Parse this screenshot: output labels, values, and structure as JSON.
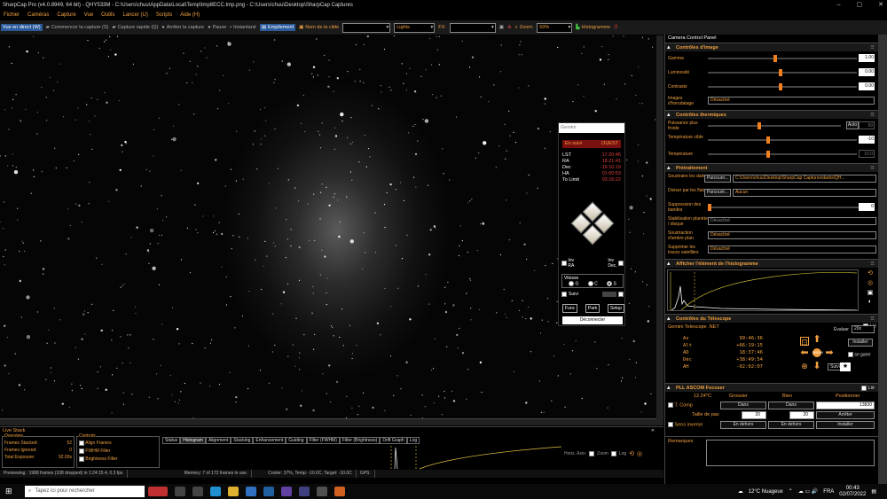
{
  "title": "SharpCap Pro (v4.0.8949, 64 bit) - QHY533M - C:\\Users\\chuu\\AppData\\Local\\Temp\\tmp8ECC.tmp.png - C:\\Users\\chuu\\Desktop\\SharpCap Captures",
  "menu": [
    "Fichier",
    "Caméras",
    "Capture",
    "Vue",
    "Outils",
    "Lancer (U)",
    "Scripts",
    "Aide (H)"
  ],
  "toolbar": {
    "live": "Vue en direct (W)",
    "start": "Commencer la capture (S)",
    "quick": "Capture rapide (Q)",
    "stop": "Arrêter la capture",
    "pause": "Pause",
    "snap": "Instantané",
    "stack": "Empilement",
    "target": "Nom de la cible",
    "preset": "Lights",
    "fx": "FX:",
    "zoom": "Zoom:",
    "zoom_val": "50%",
    "histo": "Histogramme"
  },
  "gemini": {
    "title": "Gemini",
    "status_l": "En suivi",
    "status_r": "OUEST",
    "rows": [
      [
        "LST",
        "17:20:45"
      ],
      [
        "RA",
        "18:21:41"
      ],
      [
        "Dec",
        "-16:10:19"
      ],
      [
        "HA",
        "01:00:53"
      ],
      [
        "To Limit",
        "03:16:22"
      ]
    ],
    "inv_ra": "Inv\nRA",
    "inv_dec": "Inv\nDec.",
    "speed": "Vitesse",
    "g": "G",
    "c": "C",
    "s": "S",
    "suivi": "Suivi",
    "func": "Func",
    "park": "Park",
    "setup": "Setup",
    "disconnect": "Déconnecter"
  },
  "panel": {
    "title": "Camera Control Panel",
    "img": {
      "head": "Contrôles d'image",
      "gamma": "Gamma",
      "gamma_v": "1.00",
      "lum": "Luminosité",
      "lum_v": "0.00",
      "con": "Contraste",
      "con_v": "0.00",
      "ts": "Images d'horodatage",
      "ts_v": "Désactivé"
    },
    "therm": {
      "head": "Contrôles thermiques",
      "power": "Puissance plus froide",
      "auto": "Auto",
      "auto_v": "99",
      "target": "Température cible",
      "target_v": "-10",
      "temp": "Température",
      "temp_v": "10.0"
    },
    "pre": {
      "head": "Prétraitement",
      "dark": "Soustraire les darks",
      "browse": "Parcourir...",
      "dark_v": "C:\\Users\\chuu\\Desktop\\SharpCap Captures\\darks\\QH...",
      "flat": "Diviser par les flats",
      "flat_v": "Aucun",
      "band": "Suppression des bandes",
      "band_v": "0",
      "stab": "Stabilisation planète / disque",
      "stab_v": "Désactivé",
      "amb": "Soustraction d'ambre plan",
      "amb_v": "Désactivé",
      "sat": "Supprimer les traces satellites",
      "sat_v": "Désactivé"
    },
    "histo": {
      "head": "Afficher l'élément de l'histogramme"
    },
    "tel": {
      "head": "Contrôles du Télescope",
      "name": "Gemini Telescope .NET",
      "linked": "Lié",
      "az": "Az",
      "az_v": "99:46:36",
      "alt": "Alt",
      "alt_v": "+66:19:15",
      "ad": "AD",
      "ad_v": "18:37:46",
      "dec": "Déc",
      "dec_v": "+38:49:54",
      "ah": "AH",
      "ah_v": "-02:02:07",
      "rate": "Évaluer",
      "rate_v": "20x",
      "install": "Installer",
      "garer": "se garer",
      "suivi": "Suivi",
      "nsew": "NSEW"
    },
    "foc": {
      "head": "PLL ASCOM Focuser",
      "linked": "Lié",
      "temp": "12.24°C",
      "grossier": "Grossier",
      "bien": "Bien",
      "pos": "Positionner",
      "tcomp": "T. Comp",
      "dans": "Dans",
      "pos_v": "13830",
      "step": "Taille de pas",
      "s1": "20",
      "s2": "20",
      "stop": "Arrêter",
      "rev": "Sens inverse",
      "out": "En dehors",
      "install": "Installer"
    },
    "remarks": "Remarques"
  },
  "live": {
    "title": "Live Stack",
    "overview": "Overview",
    "fs": "Frames Stacked:",
    "fs_v": "52",
    "fi": "Frames Ignored:",
    "fi_v": "0",
    "te": "Total Exposure:",
    "te_v": "92.00s",
    "controls": "Controls",
    "align": "Align Frames",
    "fwhm": "FWHM Filter",
    "bright": "Brightness Filter",
    "tabs": [
      "Status",
      "Histogram",
      "Alignment",
      "Stacking",
      "Enhancement",
      "Guiding",
      "Filter (FWHM)",
      "Filter (Brightness)",
      "Drift Graph",
      "Log"
    ],
    "hzoom": "Horiz. Axis:",
    "zoom": "Zoom",
    "log": "Log"
  },
  "status": [
    "Previewing : 1988 frames (108 dropped) in 1:24:15.4, 0.3 fps",
    "Memory: 7 of 172 frames in use.",
    "Cooler: 37%, Temp: -10.0C, Target: -10.0C",
    "GPS:"
  ],
  "taskbar": {
    "search": "Tapez ici pour rechercher",
    "weather": "12°C Nuageux",
    "lang": "FRA",
    "time": "00:43",
    "date": "02/07/2022"
  }
}
